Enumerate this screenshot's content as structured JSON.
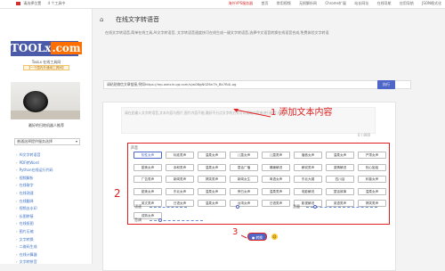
{
  "topbar": {
    "location": "请选择位置",
    "tools": "4 个工具中",
    "links": [
      "海外VPS服务器",
      "首页",
      "常用视频",
      "无损解析网",
      "Chrome扩展",
      "站长网址",
      "在线导航",
      "应用导航",
      "JSON格式化"
    ]
  },
  "sidebar": {
    "logo_main": "TOOLx",
    "logo_dot": ".com",
    "site_name": "TooLx 在线工具网",
    "tag": "【一个国内外通用工具网】",
    "ad_caption": "最好的扫地机器人推荐",
    "category_select": "普通选择提供服务选择",
    "nav": [
      "AI文字转语音",
      "PDF转Word",
      "Python在线运行代码",
      "视频解析",
      "在线取字",
      "在线测速",
      "在线翻译",
      "视频去水印",
      "长图拼接",
      "在线抠图",
      "图片压缩",
      "文字转换",
      "二维码生成",
      "在线计算器",
      "文字转拼音"
    ]
  },
  "main": {
    "home_icon": "home-icon",
    "title": "在线文字转语音",
    "intro": "在线文字转语音,简单在线工具,AI文字转语音, 文字转语音速度快可在线生成一键文字转语音,选择中文语音转换在线语音合成,免费体验文字转语",
    "url_value": "请粘贴微信文章链接,例如https://mp.weixin.qq.com/s/w0BgN0Z6n7h_Bk7B4l-og",
    "url_button": "执行",
    "textarea_placeholder": "请在此输入文字转语音,文本内容与图片,图片内容不能,最好不分点文字的方式可以读取内容来进行配音,参阅",
    "counter": "0 / 800",
    "annotation_1": "1 添加文本内容",
    "voice_label": "声音",
    "voices": [
      "知性女声",
      "标准男声",
      "温柔女声",
      "儿童女声",
      "儿童男声",
      "播音女声",
      "温柔女声",
      "严肃女声",
      "甜美女声",
      "亲和男声",
      "温柔女声",
      "童话广播",
      "暴躁解说",
      "解说男声",
      "激情解说",
      "知心姐姐",
      "广告男声",
      "新闻男声",
      "搞笑男声",
      "新闻女生",
      "粤语女声",
      "东北大嫂",
      "四川话",
      "科普女声",
      "甜美女声",
      "东北女声",
      "温柔女声",
      "旁白女声",
      "温柔男声",
      "电影解说",
      "童话故事",
      "温柔女声",
      "英文男声",
      "日语女声",
      "温柔女声",
      "台湾女声",
      "日语男声",
      "影视解说",
      "英语男声",
      "搞笑男声",
      "成熟女声"
    ],
    "selected_voice_index": 0,
    "speed_label": "语速",
    "volume_label": "音量",
    "pitch_label": "音调",
    "speed_level": 0.55,
    "volume_level": 0.12,
    "pitch_level": 0.2,
    "annotation_2": "2",
    "annotation_3": "3",
    "convert_button": "● 转换"
  },
  "colors": {
    "accent": "#4e66c7",
    "annotation": "#e02020",
    "link": "#3a6fc4"
  }
}
